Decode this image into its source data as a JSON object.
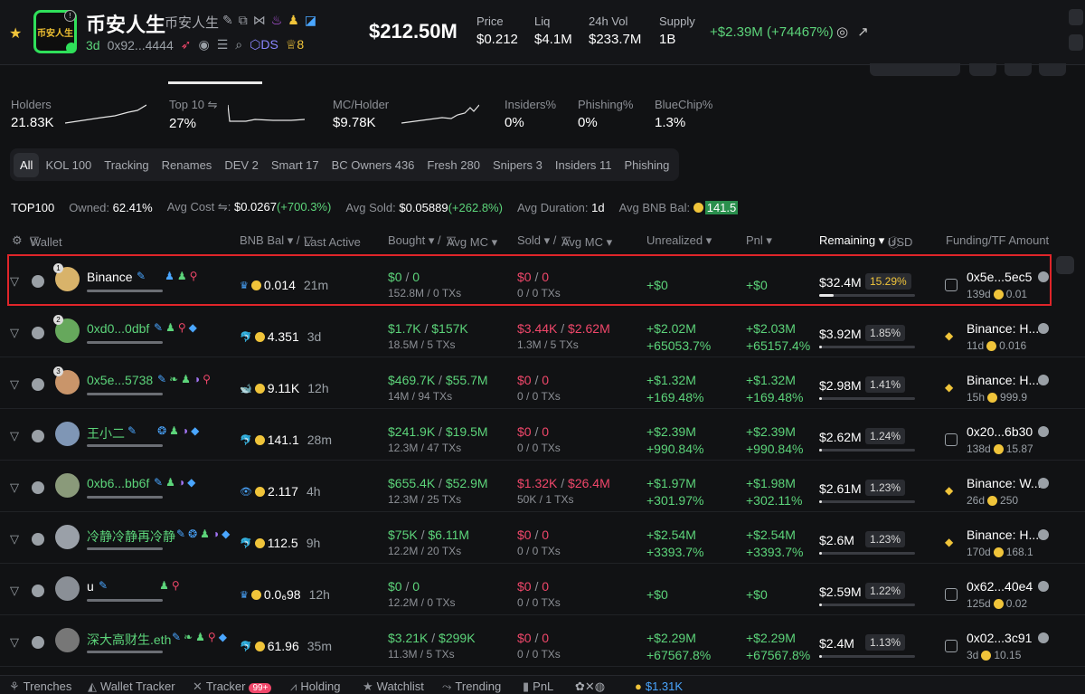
{
  "header": {
    "token_name": "币安人生",
    "token_sub": "币安人生",
    "logo_text": "币安人生",
    "age": "3d",
    "address": "0x92...4444",
    "ds_label": "DS",
    "holders_count_badge": "8",
    "market_cap": "$212.50M",
    "price_label": "Price",
    "price": "$0.212",
    "liq_label": "Liq",
    "liq": "$4.1M",
    "vol_label": "24h Vol",
    "vol": "$233.7M",
    "supply_label": "Supply",
    "supply": "1B",
    "change": "+$2.39M (+74467%)"
  },
  "stats": {
    "holders_label": "Holders",
    "holders": "21.83K",
    "top10_label": "Top 10 ⇋",
    "top10": "27%",
    "mc_holder_label": "MC/Holder",
    "mc_holder": "$9.78K",
    "insiders_label": "Insiders%",
    "insiders": "0%",
    "phishing_label": "Phishing%",
    "phishing": "0%",
    "bluechip_label": "BlueChip%",
    "bluechip": "1.3%"
  },
  "filter_tabs": [
    "All",
    "KOL 100",
    "Tracking",
    "Renames",
    "DEV 2",
    "Smart 17",
    "BC Owners 436",
    "Fresh 280",
    "Snipers 3",
    "Insiders 11",
    "Phishing"
  ],
  "summary": {
    "top": "TOP100",
    "owned_label": "Owned:",
    "owned": "62.41%",
    "avg_cost_label": "Avg Cost ⇋:",
    "avg_cost": "$0.0267",
    "avg_cost_pct": "(+700.3%)",
    "avg_sold_label": "Avg Sold:",
    "avg_sold": "$0.05889",
    "avg_sold_pct": "(+262.8%)",
    "avg_dur_label": "Avg Duration:",
    "avg_dur": "1d",
    "avg_bnb_label": "Avg BNB Bal:",
    "avg_bnb": "141.5"
  },
  "table_header": {
    "wallet": "Wallet",
    "bnb_bal": "BNB Bal ▾ /",
    "last_active": "Last Active",
    "bought": "Bought ▾ /",
    "avg_mc1": "Avg MC ▾",
    "sold": "Sold ▾ /",
    "avg_mc2": "Avg MC ▾",
    "unrealized": "Unrealized ▾",
    "pnl": "Pnl ▾",
    "remaining": "Remaining ▾",
    "usd": "USD",
    "funding": "Funding/TF Amount"
  },
  "rows": [
    {
      "rank": "1",
      "name": "Binance",
      "name_white": true,
      "bnb_emoji": "♛",
      "bnb": "0.014",
      "age": "21m",
      "bought_usd": "$0",
      "bought_mc": "0",
      "bought_sub": "152.8M / 0 TXs",
      "sold_usd": "$0",
      "sold_mc": "0",
      "sold_sub": "0 / 0 TXs",
      "unreal": "+$0",
      "unreal_pct": "",
      "pnl": "+$0",
      "pnl_pct": "",
      "remain": "$32.4M",
      "remain_pct": "15.29%",
      "remain_frac": 0.15,
      "fund": "0x5e...5ec5",
      "fund_sub": "139d",
      "fund_amt": "0.01",
      "fund_bn": false
    },
    {
      "rank": "2",
      "name": "0xd0...0dbf",
      "name_white": false,
      "bnb_emoji": "🐬",
      "bnb": "4.351",
      "age": "3d",
      "bought_usd": "$1.7K",
      "bought_mc": "$157K",
      "bought_sub": "18.5M / 5 TXs",
      "sold_usd": "$3.44K",
      "sold_mc": "$2.62M",
      "sold_sub": "1.3M / 5 TXs",
      "unreal": "+$2.02M",
      "unreal_pct": "+65053.7%",
      "pnl": "+$2.03M",
      "pnl_pct": "+65157.4%",
      "remain": "$3.92M",
      "remain_pct": "1.85%",
      "remain_frac": 0.02,
      "fund": "Binance: H...",
      "fund_sub": "11d",
      "fund_amt": "0.016",
      "fund_bn": true
    },
    {
      "rank": "3",
      "name": "0x5e...5738",
      "name_white": false,
      "bnb_emoji": "🐋",
      "bnb": "9.11K",
      "age": "12h",
      "bought_usd": "$469.7K",
      "bought_mc": "$55.7M",
      "bought_sub": "14M / 94 TXs",
      "sold_usd": "$0",
      "sold_mc": "0",
      "sold_sub": "0 / 0 TXs",
      "unreal": "+$1.32M",
      "unreal_pct": "+169.48%",
      "pnl": "+$1.32M",
      "pnl_pct": "+169.48%",
      "remain": "$2.98M",
      "remain_pct": "1.41%",
      "remain_frac": 0.015,
      "fund": "Binance: H...",
      "fund_sub": "15h",
      "fund_amt": "999.9",
      "fund_bn": true
    },
    {
      "rank": "",
      "name": "王小二",
      "name_white": false,
      "bnb_emoji": "🐬",
      "bnb": "141.1",
      "age": "28m",
      "bought_usd": "$241.9K",
      "bought_mc": "$19.5M",
      "bought_sub": "12.3M / 47 TXs",
      "sold_usd": "$0",
      "sold_mc": "0",
      "sold_sub": "0 / 0 TXs",
      "unreal": "+$2.39M",
      "unreal_pct": "+990.84%",
      "pnl": "+$2.39M",
      "pnl_pct": "+990.84%",
      "remain": "$2.62M",
      "remain_pct": "1.24%",
      "remain_frac": 0.012,
      "fund": "0x20...6b30",
      "fund_sub": "138d",
      "fund_amt": "15.87",
      "fund_bn": false
    },
    {
      "rank": "",
      "name": "0xb6...bb6f",
      "name_white": false,
      "bnb_emoji": "👁",
      "bnb": "2.117",
      "age": "4h",
      "bought_usd": "$655.4K",
      "bought_mc": "$52.9M",
      "bought_sub": "12.3M / 25 TXs",
      "sold_usd": "$1.32K",
      "sold_mc": "$26.4M",
      "sold_sub": "50K / 1 TXs",
      "unreal": "+$1.97M",
      "unreal_pct": "+301.97%",
      "pnl": "+$1.98M",
      "pnl_pct": "+302.11%",
      "remain": "$2.61M",
      "remain_pct": "1.23%",
      "remain_frac": 0.012,
      "fund": "Binance: W...",
      "fund_sub": "26d",
      "fund_amt": "250",
      "fund_bn": true
    },
    {
      "rank": "",
      "name": "冷静冷静再冷静",
      "name_white": false,
      "bnb_emoji": "🐬",
      "bnb": "112.5",
      "age": "9h",
      "bought_usd": "$75K",
      "bought_mc": "$6.11M",
      "bought_sub": "12.2M / 20 TXs",
      "sold_usd": "$0",
      "sold_mc": "0",
      "sold_sub": "0 / 0 TXs",
      "unreal": "+$2.54M",
      "unreal_pct": "+3393.7%",
      "pnl": "+$2.54M",
      "pnl_pct": "+3393.7%",
      "remain": "$2.6M",
      "remain_pct": "1.23%",
      "remain_frac": 0.012,
      "fund": "Binance: H...",
      "fund_sub": "170d",
      "fund_amt": "168.1",
      "fund_bn": true
    },
    {
      "rank": "",
      "name": "u",
      "name_white": true,
      "bnb_emoji": "♛",
      "bnb": "0.0₆98",
      "age": "12h",
      "bought_usd": "$0",
      "bought_mc": "0",
      "bought_sub": "12.2M / 0 TXs",
      "sold_usd": "$0",
      "sold_mc": "0",
      "sold_sub": "0 / 0 TXs",
      "unreal": "+$0",
      "unreal_pct": "",
      "pnl": "+$0",
      "pnl_pct": "",
      "remain": "$2.59M",
      "remain_pct": "1.22%",
      "remain_frac": 0.012,
      "fund": "0x62...40e4",
      "fund_sub": "125d",
      "fund_amt": "0.02",
      "fund_bn": false
    },
    {
      "rank": "",
      "name": "深大高财生.eth",
      "name_white": false,
      "bnb_emoji": "🐬",
      "bnb": "61.96",
      "age": "35m",
      "bought_usd": "$3.21K",
      "bought_mc": "$299K",
      "bought_sub": "11.3M / 5 TXs",
      "sold_usd": "$0",
      "sold_mc": "0",
      "sold_sub": "0 / 0 TXs",
      "unreal": "+$2.29M",
      "unreal_pct": "+67567.8%",
      "pnl": "+$2.29M",
      "pnl_pct": "+67567.8%",
      "remain": "$2.4M",
      "remain_pct": "1.13%",
      "remain_frac": 0.011,
      "fund": "0x02...3c91",
      "fund_sub": "3d",
      "fund_amt": "10.15",
      "fund_bn": false
    }
  ],
  "footer": {
    "trenches": "Trenches",
    "wallet_tracker": "Wallet Tracker",
    "tracker": "Tracker",
    "tracker_badge": "99+",
    "holding": "Holding",
    "watchlist": "Watchlist",
    "trending": "Trending",
    "pnl": "PnL",
    "balance": "$1.31K"
  },
  "colors": {
    "accent_green": "#5cd47a",
    "accent_red": "#f0476a",
    "highlight": "#e0252a",
    "gold": "#f0c43a"
  }
}
